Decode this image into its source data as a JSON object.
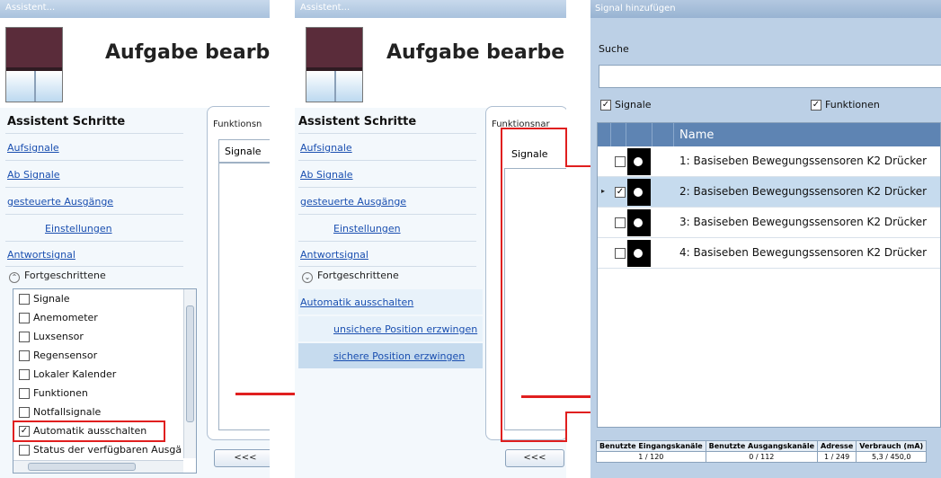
{
  "panel1": {
    "window_title": "Assistent...",
    "big_title": "Aufgabe bearbeiten",
    "steps_title": "Assistent Schritte",
    "links": [
      "Aufsignale",
      "Ab Signale",
      "gesteuerte Ausgänge",
      "Einstellungen",
      "Antwortsignal"
    ],
    "advanced_label": "Fortgeschrittene",
    "list_items": [
      {
        "label": "Signale",
        "checked": false
      },
      {
        "label": "Anemometer",
        "checked": false
      },
      {
        "label": "Luxsensor",
        "checked": false
      },
      {
        "label": "Regensensor",
        "checked": false
      },
      {
        "label": "Lokaler Kalender",
        "checked": false
      },
      {
        "label": "Funktionen",
        "checked": false
      },
      {
        "label": "Notfallsignale",
        "checked": false
      },
      {
        "label": "Automatik ausschalten",
        "checked": true
      },
      {
        "label": "Status der verfügbaren Ausgä",
        "checked": false
      }
    ],
    "functions_label": "Funktionsn",
    "tab_label": "Signale",
    "back_label": "<<<"
  },
  "panel2": {
    "window_title": "Assistent...",
    "big_title": "Aufgabe bearbeiten",
    "steps_title": "Assistent Schritte",
    "links": [
      "Aufsignale",
      "Ab Signale",
      "gesteuerte Ausgänge",
      "Einstellungen",
      "Antwortsignal"
    ],
    "advanced_label": "Fortgeschrittene",
    "adv_links": [
      "Automatik ausschalten",
      "unsichere Position erzwingen",
      "sichere Position erzwingen"
    ],
    "functions_label": "Funktionsnar",
    "tab_label": "Signale",
    "back_label": "<<<"
  },
  "dialog": {
    "title": "Signal hinzufügen",
    "search_label": "Suche",
    "search_value": "",
    "filter_signals": "Signale",
    "filter_functions": "Funktionen",
    "column_name": "Name",
    "rows": [
      {
        "name": "1: Basiseben Bewegungssensoren K2 Drücker",
        "checked": false,
        "selected": false
      },
      {
        "name": "2: Basiseben Bewegungssensoren K2 Drücker",
        "checked": true,
        "selected": true
      },
      {
        "name": "3: Basiseben Bewegungssensoren K2 Drücker",
        "checked": false,
        "selected": false
      },
      {
        "name": "4: Basiseben Bewegungssensoren K2 Drücker",
        "checked": false,
        "selected": false
      }
    ],
    "footer_headers": [
      "Benutzte Eingangskanäle",
      "Benutzte Ausgangskanäle",
      "Adresse",
      "Verbrauch (mA)"
    ],
    "footer_values": [
      "1 / 120",
      "0 / 112",
      "1 / 249",
      "5,3 / 450,0"
    ]
  },
  "colors": {
    "highlight": "#e01f1f",
    "link": "#1a4fb0",
    "grid_header": "#5e84b3",
    "selected_row": "#c6dbee"
  }
}
